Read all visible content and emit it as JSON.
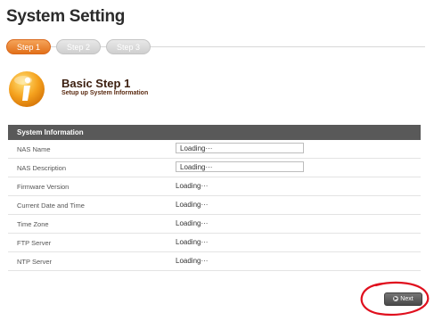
{
  "page": {
    "title": "System Setting"
  },
  "steps": [
    {
      "label": "Step 1",
      "active": true
    },
    {
      "label": "Step 2",
      "active": false
    },
    {
      "label": "Step 3",
      "active": false
    }
  ],
  "intro": {
    "icon": "info-icon",
    "heading": "Basic Step 1",
    "subheading": "Setup up System Information"
  },
  "panel": {
    "header": "System Information",
    "rows": [
      {
        "label": "NAS Name",
        "value": "Loading···",
        "kind": "input"
      },
      {
        "label": "NAS Description",
        "value": "Loading···",
        "kind": "input"
      },
      {
        "label": "Firmware Version",
        "value": "Loading···",
        "kind": "text"
      },
      {
        "label": "Current Date and Time",
        "value": "Loading···",
        "kind": "text"
      },
      {
        "label": "Time Zone",
        "value": "Loading···",
        "kind": "text"
      },
      {
        "label": "FTP Server",
        "value": "Loading···",
        "kind": "text"
      },
      {
        "label": "NTP Server",
        "value": "Loading···",
        "kind": "text"
      }
    ]
  },
  "footer": {
    "next_label": "Next"
  },
  "colors": {
    "accent": "#e2701a",
    "header_bg": "#595959",
    "annotation": "#e0101e"
  }
}
